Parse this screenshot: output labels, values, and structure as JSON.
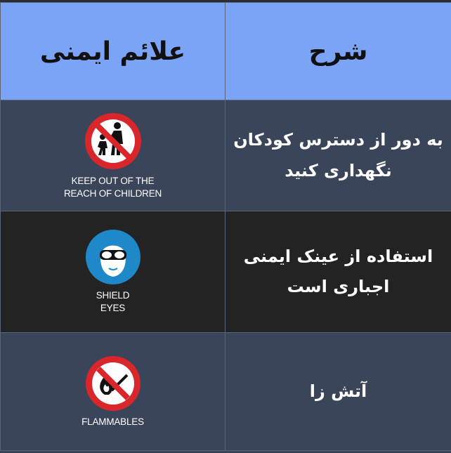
{
  "table": {
    "header_signs": "علائم ایمنی",
    "header_desc": "شرح",
    "rows": [
      {
        "sign_icon": "no-children-icon",
        "sign_caption_line1": "KEEP OUT OF THE",
        "sign_caption_line2": "REACH OF CHILDREN",
        "desc_line1": "به دور از دسترس کودکان",
        "desc_line2": "نگهداری کنید"
      },
      {
        "sign_icon": "goggles-icon",
        "sign_caption_line1": "SHIELD",
        "sign_caption_line2": "EYES",
        "desc_line1": "استفاده از عینک ایمنی",
        "desc_line2": "اجباری است"
      },
      {
        "sign_icon": "no-flame-icon",
        "sign_caption_line1": "FLAMMABLES",
        "desc_line1": "آتش زا"
      }
    ]
  },
  "colors": {
    "header_bg": "#7ba4f6",
    "row_bg": "#3b4559",
    "row_dark_bg": "#232323",
    "prohibition_red": "#d8262a",
    "mandatory_blue": "#1e88c8"
  }
}
